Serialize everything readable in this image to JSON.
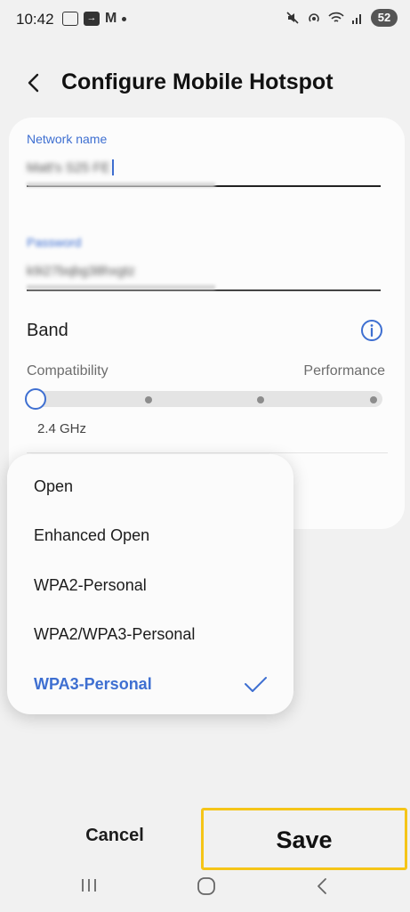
{
  "status_bar": {
    "time": "10:42",
    "battery": "52",
    "left_icons": [
      "screenshot-icon",
      "cast-icon",
      "gmail-icon",
      "notification-dot-icon"
    ],
    "right_icons": [
      "mute-icon",
      "hotspot-icon",
      "wifi-icon",
      "signal-icon",
      "battery-icon"
    ]
  },
  "header": {
    "title": "Configure Mobile Hotspot",
    "back_icon": "chevron-left-icon"
  },
  "form": {
    "network_name_label": "Network name",
    "network_name_value": "Matt's S25 FE",
    "password_label": "Password",
    "password_value": "k9i27bqbg38hxgtz",
    "band_label": "Band",
    "info_icon": "info-icon",
    "compatibility_label": "Compatibility",
    "performance_label": "Performance",
    "band_value": "2.4 GHz",
    "band_steps": 4,
    "band_selected_index": 0
  },
  "security_dropdown": {
    "options": [
      "Open",
      "Enhanced Open",
      "WPA2-Personal",
      "WPA2/WPA3-Personal",
      "WPA3-Personal"
    ],
    "selected_index": 4,
    "check_icon": "checkmark-icon"
  },
  "actions": {
    "cancel_label": "Cancel",
    "save_label": "Save"
  },
  "colors": {
    "accent": "#3e6fd1",
    "highlight_border": "#f5c518",
    "background": "#f1f1f1"
  },
  "nav_bar": {
    "icons": [
      "recent-apps-icon",
      "home-icon",
      "back-icon"
    ]
  }
}
